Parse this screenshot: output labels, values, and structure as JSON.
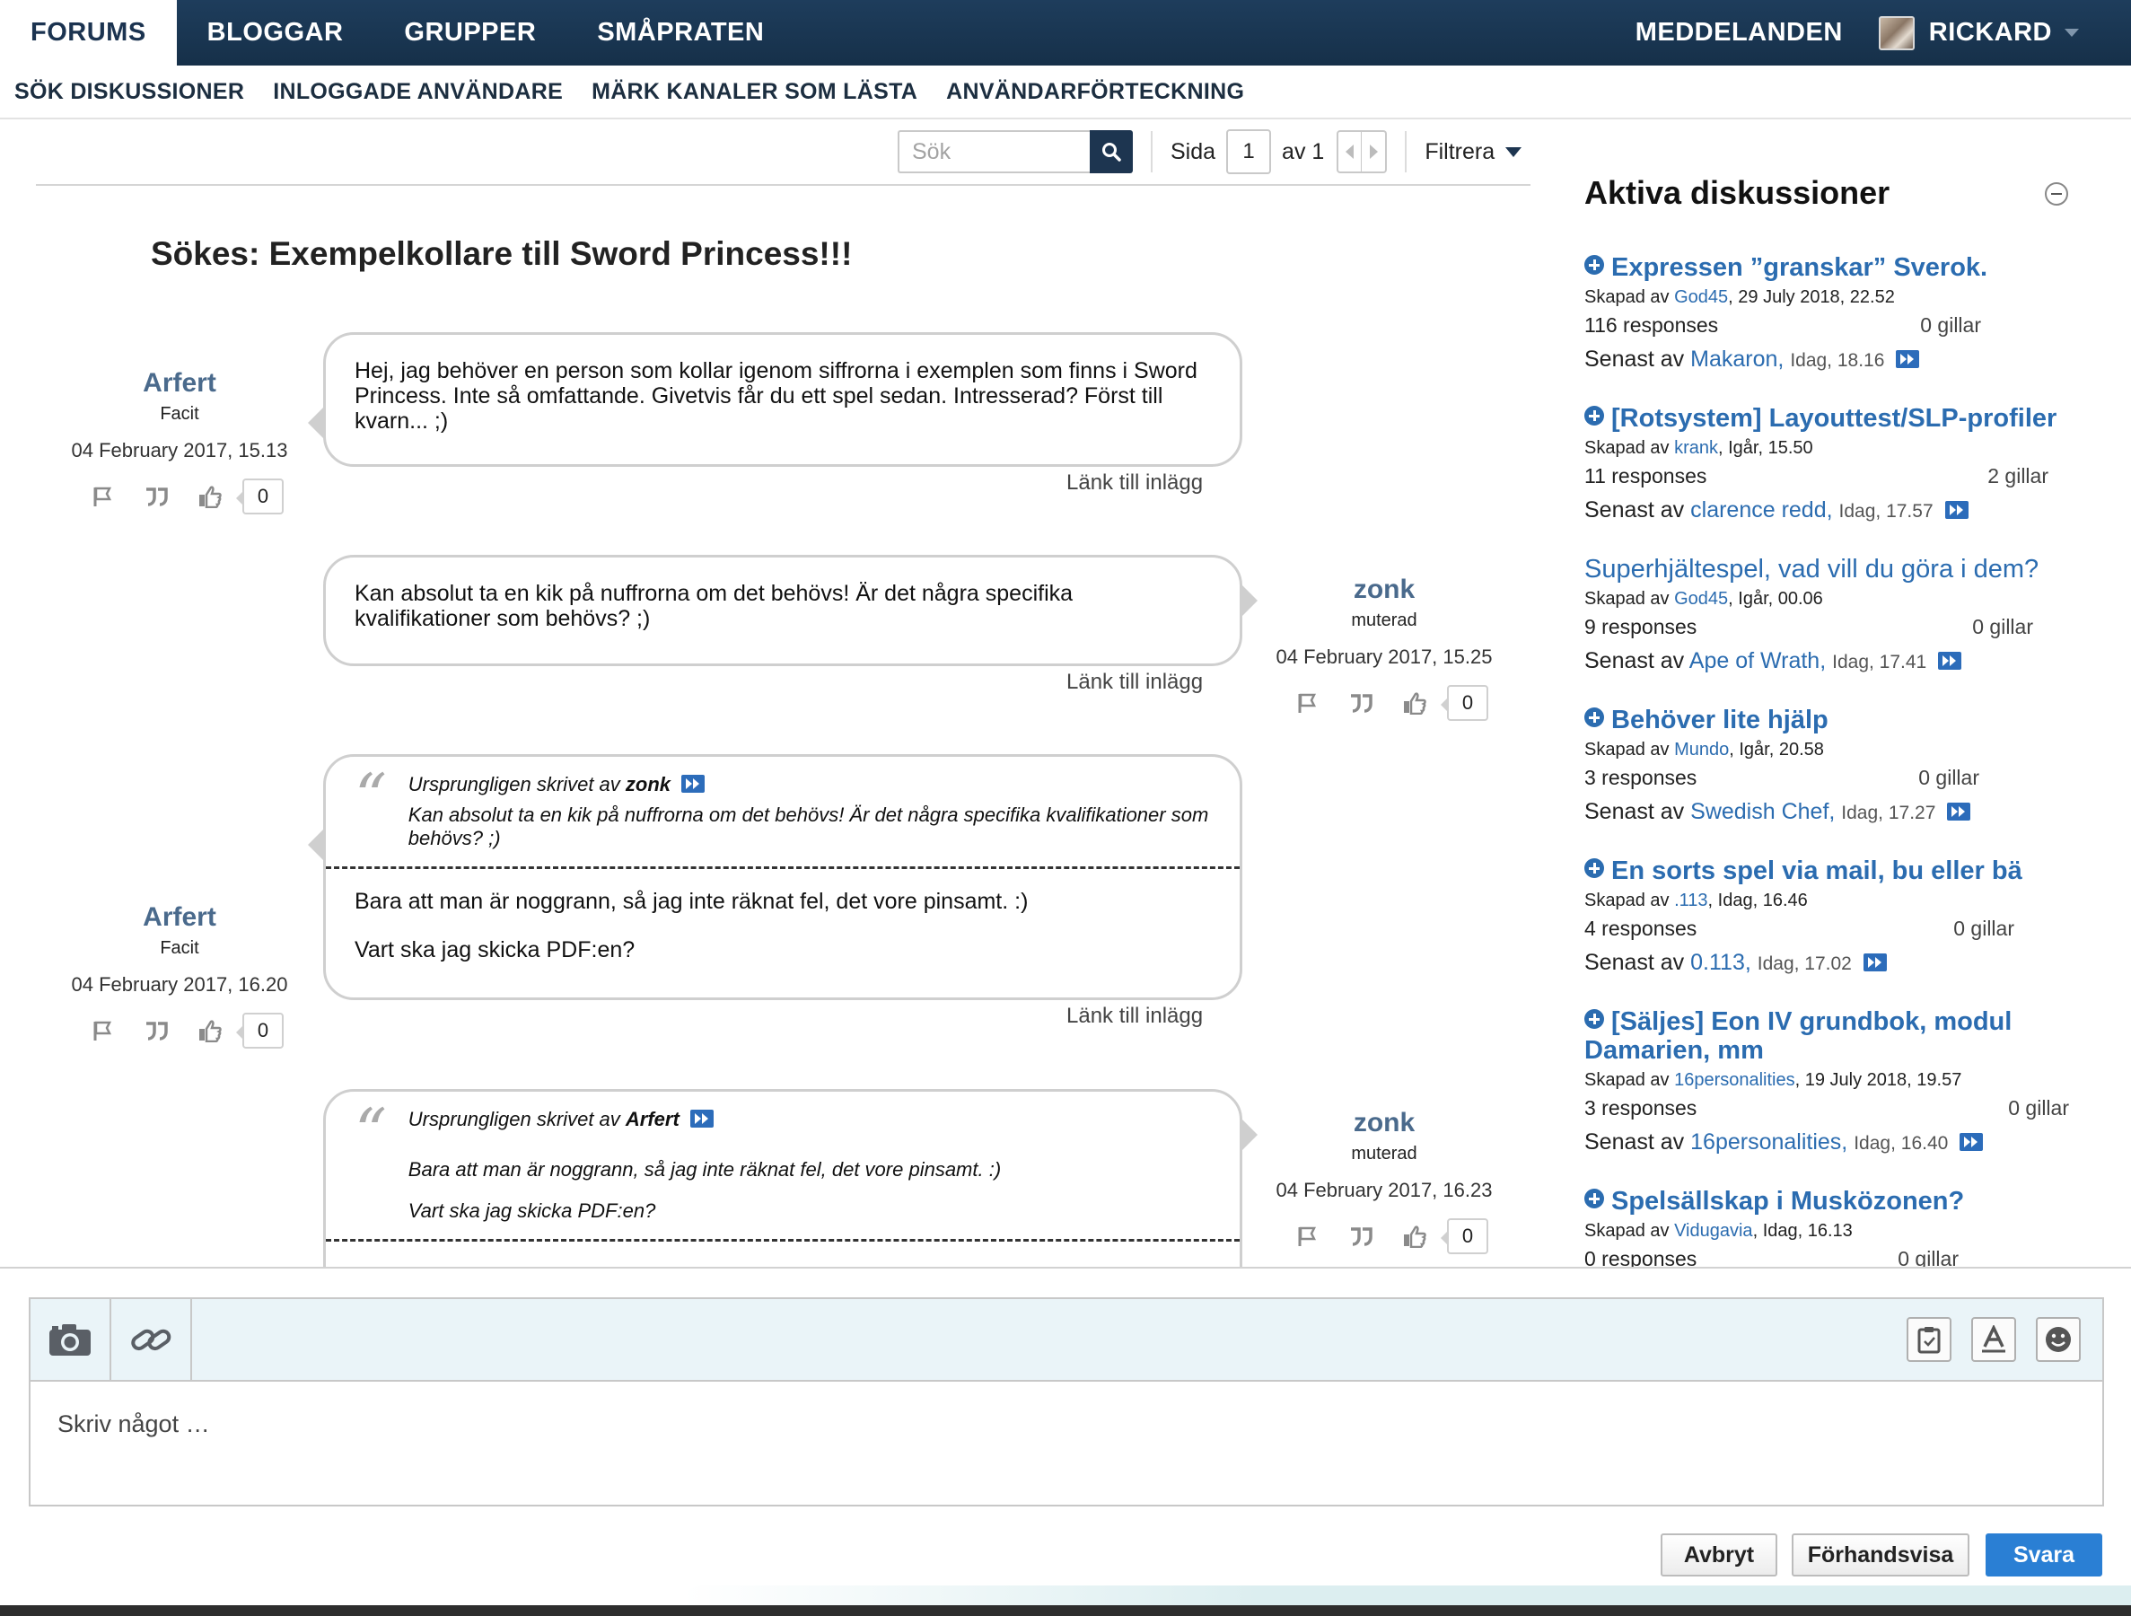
{
  "topnav": {
    "tabs": [
      "FORUMS",
      "BLOGGAR",
      "GRUPPER",
      "SMÅPRATEN"
    ],
    "messages": "MEDDELANDEN",
    "user": "RICKARD"
  },
  "subnav": [
    "SÖK DISKUSSIONER",
    "INLOGGADE ANVÄNDARE",
    "MÄRK KANALER SOM LÄSTA",
    "ANVÄNDARFÖRTECKNING"
  ],
  "toolbar": {
    "search_placeholder": "Sök",
    "page_label": "Sida",
    "page_value": "1",
    "of_label": "av 1",
    "filter": "Filtrera"
  },
  "thread": {
    "title": "Sökes: Exempelkollare till Sword Princess!!!",
    "link_label": "Länk till inlägg",
    "posts": [
      {
        "author": "Arfert",
        "role": "Facit",
        "date": "04 February 2017, 15.13",
        "likes": "0",
        "text": "Hej, jag behöver en person som kollar igenom siffrorna i exemplen som finns i Sword Princess. Inte så omfattande. Givetvis får du ett spel sedan. Intresserad? Först till kvarn... ;)"
      },
      {
        "author": "zonk",
        "role": "muterad",
        "date": "04 February 2017, 15.25",
        "likes": "0",
        "text": "Kan absolut ta en kik på nuffrorna om det behövs! Är det några specifika kvalifikationer som behövs? ;)"
      },
      {
        "author": "Arfert",
        "role": "Facit",
        "date": "04 February 2017, 16.20",
        "likes": "0",
        "quote_prefix": "Ursprungligen skrivet av",
        "quote_author": "zonk",
        "quote_text": "Kan absolut ta en kik på nuffrorna om det behövs! Är det några specifika kvalifikationer som behövs? ;)",
        "paragraphs": [
          "Bara att man är noggrann, så jag inte räknat fel, det vore pinsamt. :)",
          "Vart ska jag skicka PDF:en?"
        ]
      },
      {
        "author": "zonk",
        "role": "muterad",
        "date": "04 February 2017, 16.23",
        "likes": "0",
        "quote_prefix": "Ursprungligen skrivet av",
        "quote_author": "Arfert",
        "quote_lines": [
          "Bara att man är noggrann, så jag inte räknat fel, det vore pinsamt. :)",
          "Vart ska jag skicka PDF:en?"
        ]
      }
    ]
  },
  "sidebar": {
    "title": "Aktiva diskussioner",
    "created_prefix": "Skapad av",
    "last_prefix": "Senast av",
    "items": [
      {
        "title": "Expressen ”granskar” Sverok.",
        "new": true,
        "by": "God45",
        "when": "29 July 2018, 22.52",
        "responses": "116 responses",
        "likes": "0 gillar",
        "last_by": "Makaron,",
        "last_when": "Idag, 18.16"
      },
      {
        "title": "[Rotsystem] Layouttest/SLP-profiler",
        "new": true,
        "by": "krank",
        "when": "Igår, 15.50",
        "responses": "11 responses",
        "likes": "2 gillar",
        "last_by": "clarence redd,",
        "last_when": "Idag, 17.57"
      },
      {
        "title": "Superhjältespel, vad vill du göra i dem?",
        "new": false,
        "by": "God45",
        "when": "Igår, 00.06",
        "responses": "9 responses",
        "likes": "0 gillar",
        "last_by": "Ape of Wrath,",
        "last_when": "Idag, 17.41"
      },
      {
        "title": "Behöver lite hjälp",
        "new": true,
        "by": "Mundo",
        "when": "Igår, 20.58",
        "responses": "3 responses",
        "likes": "0 gillar",
        "last_by": "Swedish Chef,",
        "last_when": "Idag, 17.27"
      },
      {
        "title": "En sorts spel via mail, bu eller bä",
        "new": true,
        "by": ".113",
        "when": "Idag, 16.46",
        "responses": "4 responses",
        "likes": "0 gillar",
        "last_by": "0.113,",
        "last_when": "Idag, 17.02"
      },
      {
        "title": "[Säljes] Eon IV grundbok, modul Damarien, mm",
        "new": true,
        "by": "16personalities",
        "when": "19 July 2018, 19.57",
        "responses": "3 responses",
        "likes": "0 gillar",
        "last_by": "16personalities,",
        "last_when": "Idag, 16.40"
      },
      {
        "title": "Spelsällskap i Musközonen?",
        "new": true,
        "by": "Vidugavia",
        "when": "Idag, 16.13",
        "responses": "0 responses",
        "likes": "0 gillar"
      }
    ]
  },
  "composer": {
    "placeholder": "Skriv något …",
    "cancel": "Avbryt",
    "preview": "Förhandsvisa",
    "submit": "Svara"
  },
  "colors": {
    "nav_bg": "#1b3551",
    "link": "#2b6cb0",
    "author": "#4a6a8c",
    "primary_button": "#2a7fd4"
  }
}
